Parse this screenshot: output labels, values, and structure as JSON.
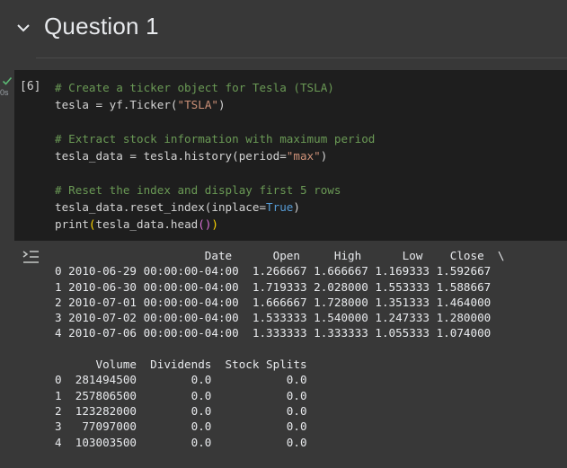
{
  "section": {
    "title": "Question 1",
    "chevron_icon": "chevron-down-icon"
  },
  "cell": {
    "status_icon": "check-icon",
    "exec_time": "0s",
    "exec_count": "[6]",
    "code_lines": [
      "# Create a ticker object for Tesla (TSLA)",
      "tesla = yf.Ticker(\"TSLA\")",
      "",
      "# Extract stock information with maximum period",
      "tesla_data = tesla.history(period=\"max\")",
      "",
      "# Reset the index and display first 5 rows",
      "tesla_data.reset_index(inplace=True)",
      "print(tesla_data.head())"
    ]
  },
  "output": {
    "icon": "output-toggle-icon",
    "table1": {
      "columns": [
        "Date",
        "Open",
        "High",
        "Low",
        "Close",
        "\\"
      ],
      "rows": [
        [
          "0",
          "2010-06-29 00:00:00-04:00",
          "1.266667",
          "1.666667",
          "1.169333",
          "1.592667"
        ],
        [
          "1",
          "2010-06-30 00:00:00-04:00",
          "1.719333",
          "2.028000",
          "1.553333",
          "1.588667"
        ],
        [
          "2",
          "2010-07-01 00:00:00-04:00",
          "1.666667",
          "1.728000",
          "1.351333",
          "1.464000"
        ],
        [
          "3",
          "2010-07-02 00:00:00-04:00",
          "1.533333",
          "1.540000",
          "1.247333",
          "1.280000"
        ],
        [
          "4",
          "2010-07-06 00:00:00-04:00",
          "1.333333",
          "1.333333",
          "1.055333",
          "1.074000"
        ]
      ]
    },
    "table2": {
      "columns": [
        "Volume",
        "Dividends",
        "Stock Splits"
      ],
      "rows": [
        [
          "0",
          "281494500",
          "0.0",
          "0.0"
        ],
        [
          "1",
          "257806500",
          "0.0",
          "0.0"
        ],
        [
          "2",
          "123282000",
          "0.0",
          "0.0"
        ],
        [
          "3",
          "77097000",
          "0.0",
          "0.0"
        ],
        [
          "4",
          "103003500",
          "0.0",
          "0.0"
        ]
      ]
    }
  },
  "colors": {
    "background": "#383838",
    "cell_background": "#1e1e1e",
    "comment": "#6a9955",
    "string": "#ce9178",
    "keyword": "#569cd6",
    "success": "#5bb974"
  }
}
